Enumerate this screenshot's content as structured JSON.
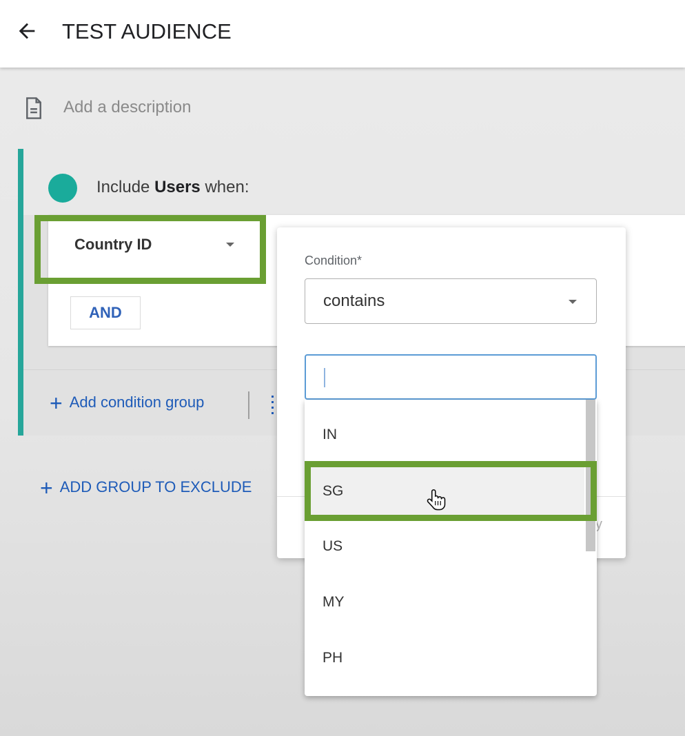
{
  "header": {
    "title": "TEST AUDIENCE",
    "back_icon": "arrow-left-icon"
  },
  "description": {
    "placeholder": "Add a description",
    "icon": "document-icon"
  },
  "group": {
    "accent_color": "#26a69a",
    "dot_color": "#1aab9b",
    "include_prefix": "Include",
    "include_subject": "Users",
    "include_suffix": "when:",
    "field": "Country ID",
    "and_label": "AND",
    "add_condition_group": "Add condition group"
  },
  "add_group_to_exclude": "ADD GROUP TO EXCLUDE",
  "condition_popup": {
    "label": "Condition*",
    "operator": "contains",
    "value_input": "",
    "partial_text": "y",
    "options": [
      "IN",
      "SG",
      "US",
      "MY",
      "PH"
    ],
    "hovered_option": "SG"
  },
  "highlight_color": "#6a9f33",
  "link_color": "#1e5bb8"
}
